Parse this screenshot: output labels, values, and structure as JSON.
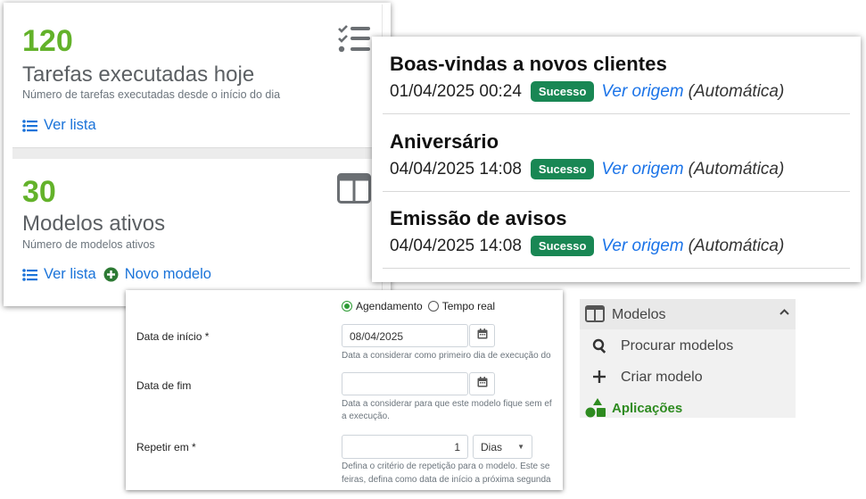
{
  "stats": {
    "tasks": {
      "number": "120",
      "title": "Tarefas executadas hoje",
      "desc": "Número de tarefas executadas desde o início do dia",
      "link_list": "Ver lista",
      "icon": "checklist-icon"
    },
    "models": {
      "number": "30",
      "title": "Modelos ativos",
      "desc": "Número de modelos ativos",
      "link_list": "Ver lista",
      "link_new": "Novo modelo",
      "icon": "columns-icon"
    }
  },
  "executions": [
    {
      "name": "Boas-vindas a novos clientes",
      "datetime": "01/04/2025 00:24",
      "status": "Sucesso",
      "link": "Ver origem",
      "type": "(Automática)"
    },
    {
      "name": "Aniversário",
      "datetime": "04/04/2025 14:08",
      "status": "Sucesso",
      "link": "Ver origem",
      "type": "(Automática)"
    },
    {
      "name": "Emissão de avisos",
      "datetime": "04/04/2025 14:08",
      "status": "Sucesso",
      "link": "Ver origem",
      "type": "(Automática)"
    }
  ],
  "form": {
    "mode_options": [
      "Agendamento",
      "Tempo real"
    ],
    "mode_selected": "Agendamento",
    "start_label": "Data de início *",
    "start_value": "08/04/2025",
    "start_help": "Data a considerar como primeiro dia de execução do",
    "end_label": "Data de fim",
    "end_value": "",
    "end_help_1": "Data a considerar para que este modelo fique sem ef",
    "end_help_2": "a execução.",
    "repeat_label": "Repetir em *",
    "repeat_value": "1",
    "repeat_unit": "Dias",
    "repeat_help_1": "Defina o critério de repetição para o modelo. Este se",
    "repeat_help_2": "feiras, defina como data de início a próxima segunda"
  },
  "menu": {
    "header": "Modelos",
    "items": [
      {
        "label": "Procurar modelos",
        "icon": "search-icon"
      },
      {
        "label": "Criar modelo",
        "icon": "plus-icon"
      },
      {
        "label": "Aplicações",
        "icon": "shapes-icon",
        "active": true
      }
    ]
  },
  "colors": {
    "green_number": "#63b22a",
    "link_blue": "#1a73d9",
    "success": "#198754",
    "active_green": "#2e8b20"
  }
}
